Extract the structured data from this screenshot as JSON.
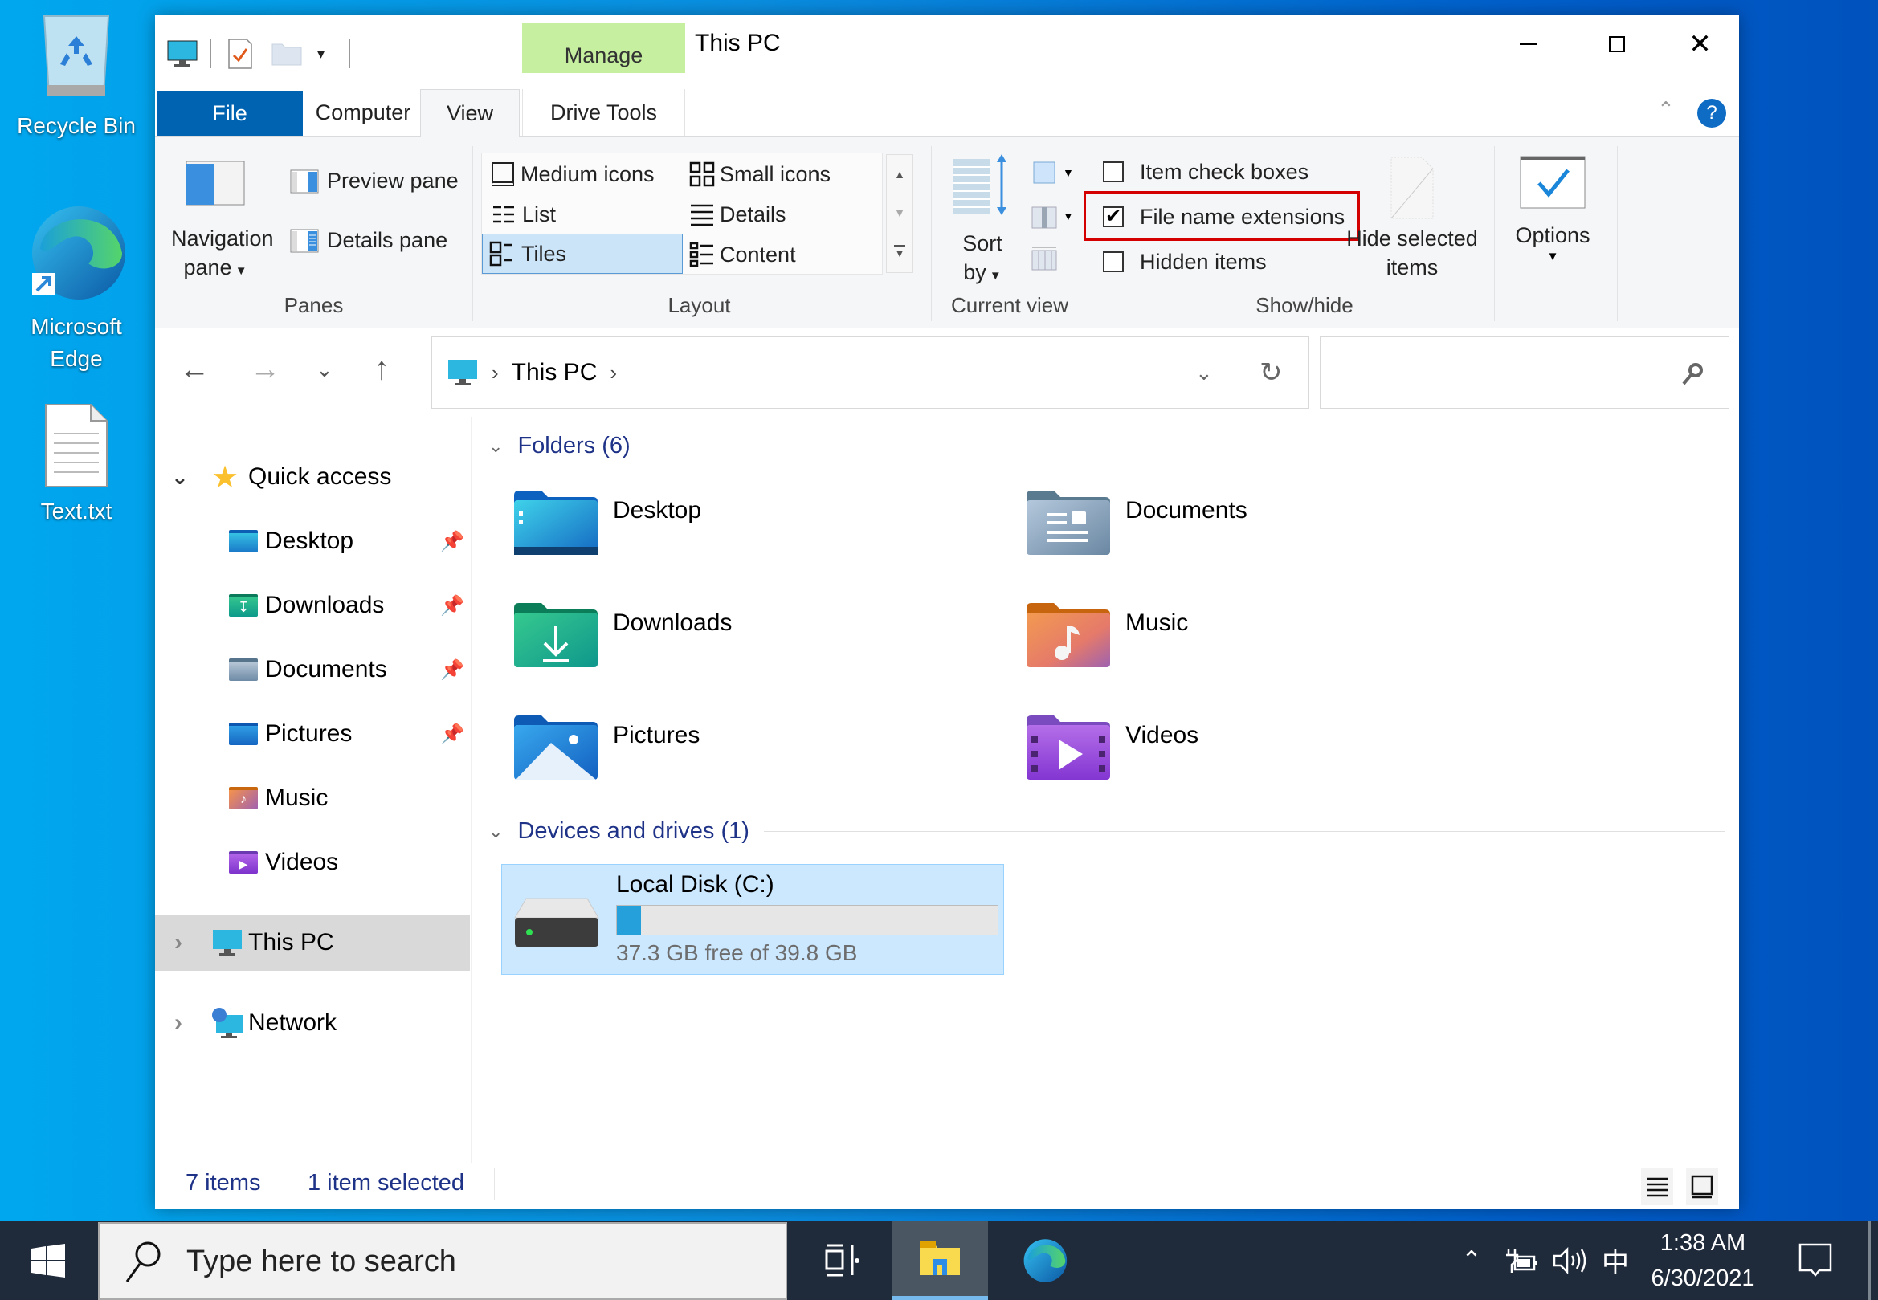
{
  "desktop": {
    "icons": [
      {
        "label": "Recycle Bin",
        "icon": "recycle-bin-icon"
      },
      {
        "label": "Microsoft Edge",
        "label_line1": "Microsoft",
        "label_line2": "Edge",
        "icon": "edge-icon"
      },
      {
        "label": "Text.txt",
        "icon": "text-file-icon"
      }
    ]
  },
  "window": {
    "title": "This PC",
    "controls": {
      "minimize": "minimize",
      "maximize": "maximize",
      "close": "close"
    },
    "quick_access_toolbar": [
      "computer-icon",
      "properties-icon",
      "new-folder-icon",
      "customize-dropdown"
    ],
    "contextual_tab_group": "Manage",
    "tabs": [
      {
        "label": "File",
        "active": false,
        "style": "file"
      },
      {
        "label": "Computer",
        "active": false
      },
      {
        "label": "View",
        "active": true
      },
      {
        "label": "Drive Tools",
        "active": false
      }
    ],
    "help": "?",
    "ribbon": {
      "panes": {
        "label": "Panes",
        "navigation_pane": {
          "line1": "Navigation",
          "line2": "pane"
        },
        "preview_pane": "Preview pane",
        "details_pane": "Details pane"
      },
      "layout": {
        "label": "Layout",
        "options": [
          {
            "label": "Medium icons",
            "selected": false
          },
          {
            "label": "Small icons",
            "selected": false
          },
          {
            "label": "List",
            "selected": false
          },
          {
            "label": "Details",
            "selected": false
          },
          {
            "label": "Tiles",
            "selected": true
          },
          {
            "label": "Content",
            "selected": false
          }
        ]
      },
      "current_view": {
        "label": "Current view",
        "sort_by": {
          "line1": "Sort",
          "line2": "by"
        }
      },
      "show_hide": {
        "label": "Show/hide",
        "item_check_boxes": {
          "label": "Item check boxes",
          "checked": false
        },
        "file_name_extensions": {
          "label": "File name extensions",
          "checked": true,
          "highlighted": true
        },
        "hidden_items": {
          "label": "Hidden items",
          "checked": false
        },
        "hide_selected": {
          "line1": "Hide selected",
          "line2": "items"
        }
      },
      "options": {
        "label": "Options"
      }
    },
    "address_bar": {
      "breadcrumb": [
        "This PC"
      ],
      "search_placeholder": ""
    },
    "nav_pane": {
      "quick_access": {
        "label": "Quick access",
        "expanded": true
      },
      "quick_access_items": [
        {
          "label": "Desktop",
          "pinned": true
        },
        {
          "label": "Downloads",
          "pinned": true
        },
        {
          "label": "Documents",
          "pinned": true
        },
        {
          "label": "Pictures",
          "pinned": true
        },
        {
          "label": "Music",
          "pinned": false
        },
        {
          "label": "Videos",
          "pinned": false
        }
      ],
      "this_pc": {
        "label": "This PC",
        "selected": true
      },
      "network": {
        "label": "Network"
      }
    },
    "content": {
      "folders_header": "Folders (6)",
      "folders": [
        {
          "label": "Desktop"
        },
        {
          "label": "Documents"
        },
        {
          "label": "Downloads"
        },
        {
          "label": "Music"
        },
        {
          "label": "Pictures"
        },
        {
          "label": "Videos"
        }
      ],
      "drives_header": "Devices and drives (1)",
      "drives": [
        {
          "label": "Local Disk (C:)",
          "free_text": "37.3 GB free of 39.8 GB",
          "used_fraction": 0.063,
          "selected": true
        }
      ]
    },
    "status": {
      "items": "7 items",
      "selected": "1 item selected"
    }
  },
  "taskbar": {
    "search_placeholder": "Type here to search",
    "time": "1:38 AM",
    "date": "6/30/2021",
    "ime": "中",
    "apps": [
      "task-view",
      "file-explorer",
      "edge"
    ]
  },
  "colors": {
    "accent": "#0063b1",
    "manage_tab": "#c6efa0",
    "selection": "#cce8ff",
    "highlight_box": "#d40000",
    "link_blue": "#1e3287",
    "progress": "#26a0da"
  }
}
